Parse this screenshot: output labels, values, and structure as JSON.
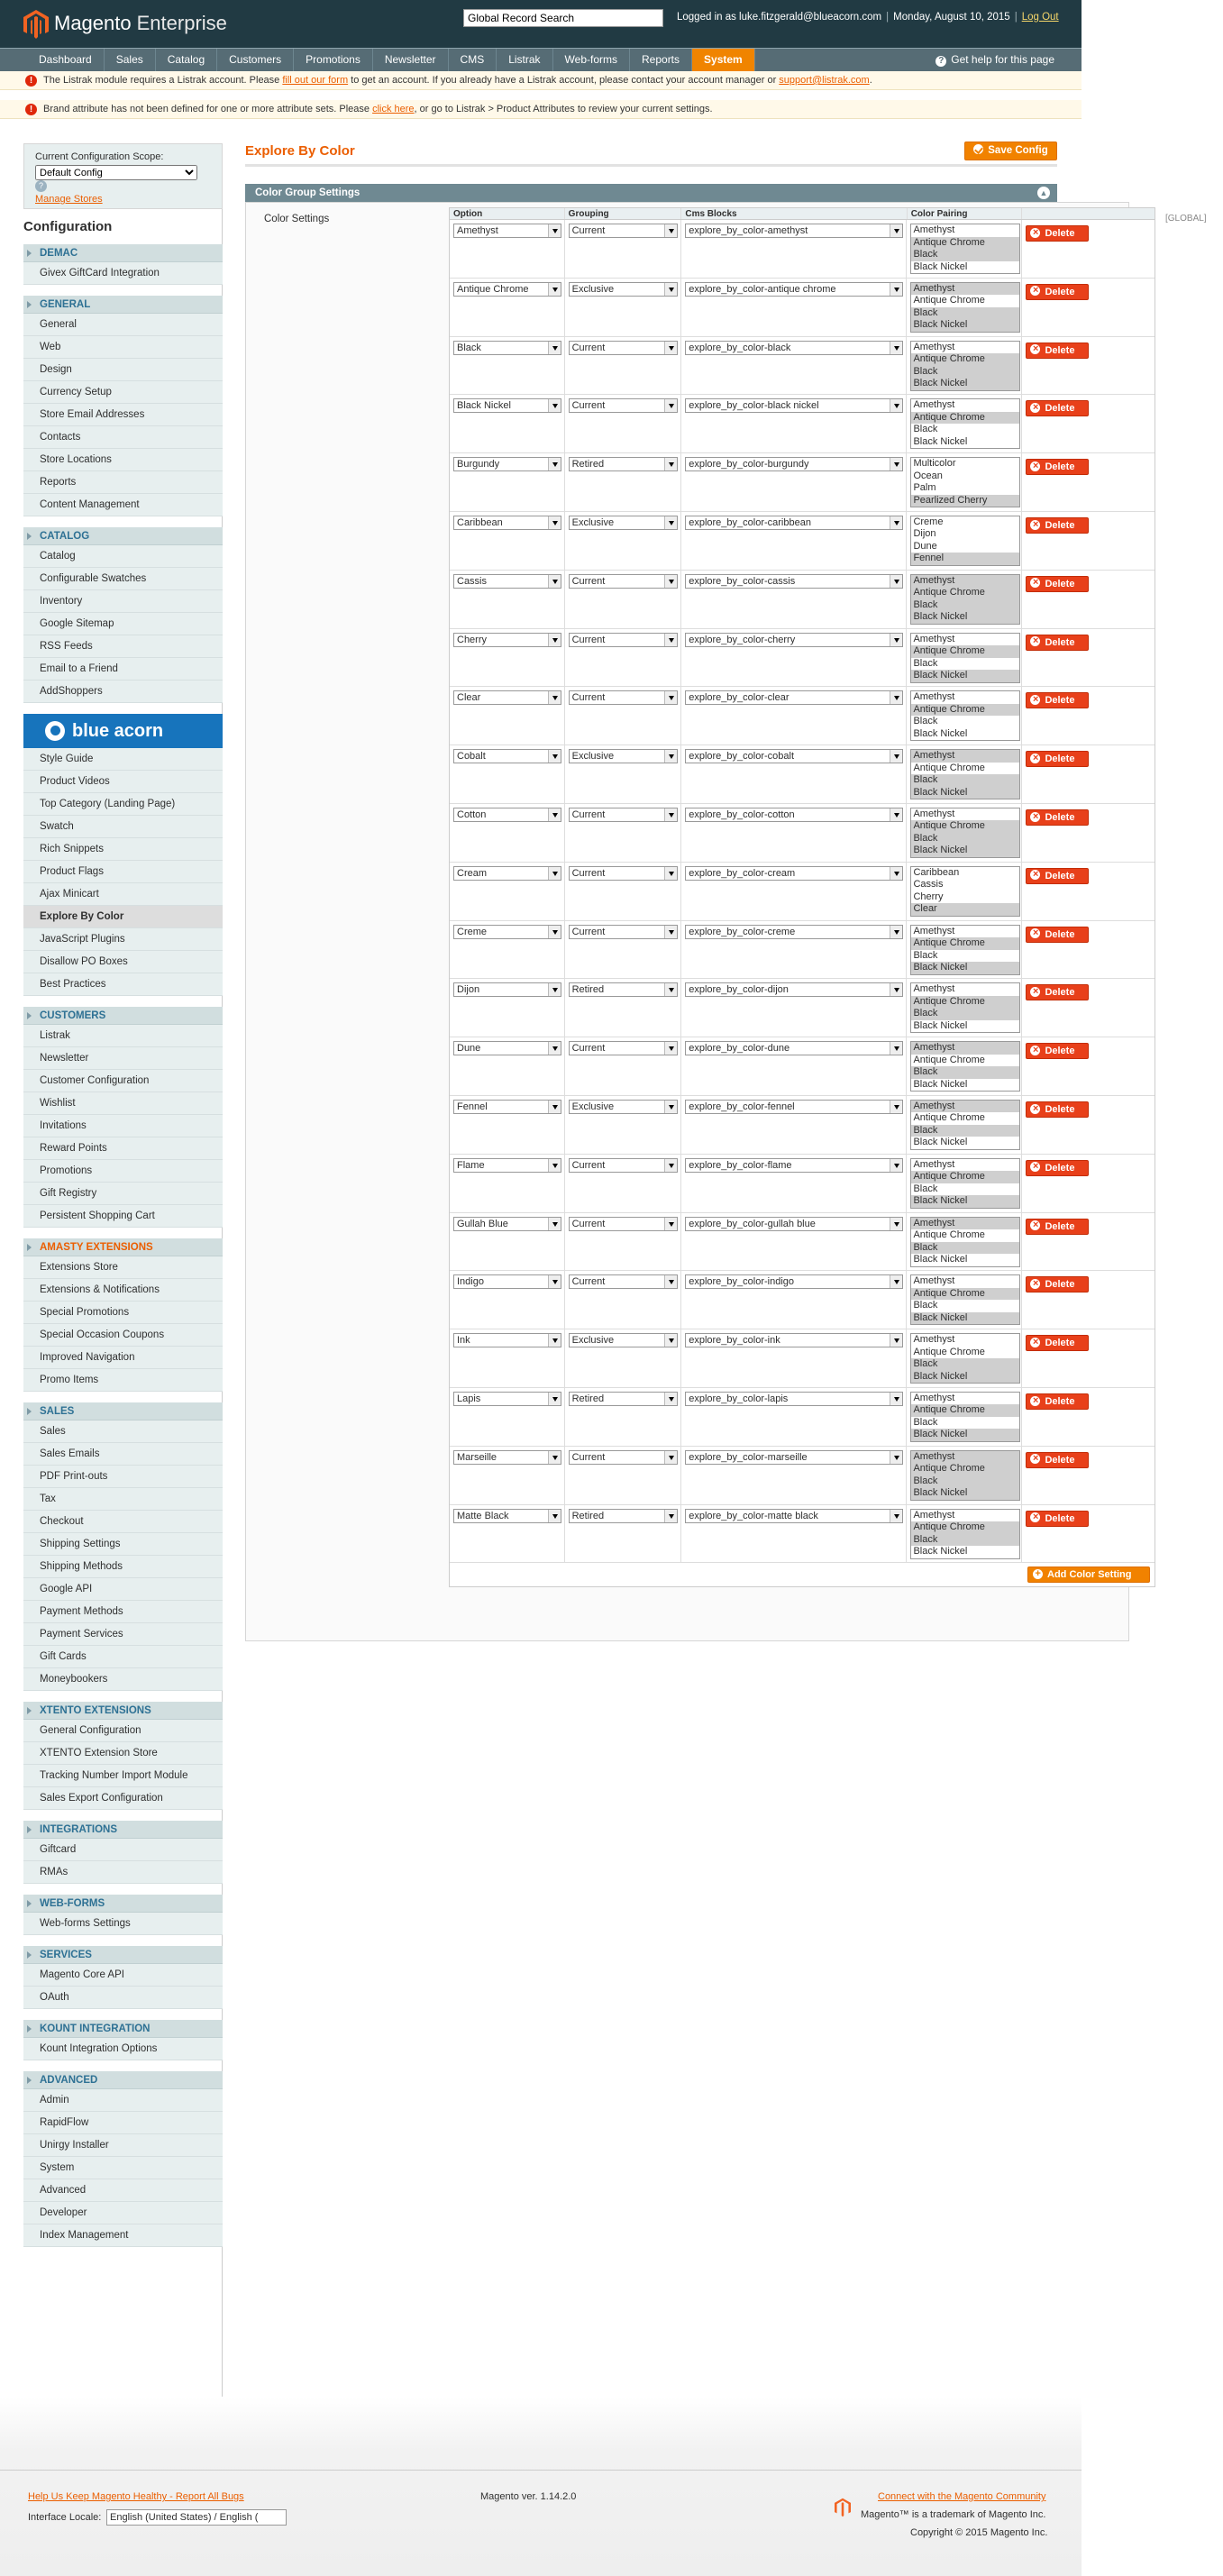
{
  "header": {
    "brand": "Magento",
    "brand_sub": "Enterprise",
    "search_value": "Global Record Search",
    "logged_in": "Logged in as luke.fitzgerald@blueacorn.com",
    "date": "Monday, August 10, 2015",
    "logout": "Log Out"
  },
  "nav": {
    "items": [
      "Dashboard",
      "Sales",
      "Catalog",
      "Customers",
      "Promotions",
      "Newsletter",
      "CMS",
      "Listrak",
      "Web-forms",
      "Reports",
      "System"
    ],
    "active": "System",
    "help": "Get help for this page"
  },
  "messages": {
    "m1_a": "The Listrak module requires a Listrak account. Please ",
    "m1_link1": "fill out our form",
    "m1_b": " to get an account. If you already have a Listrak account, please contact your account manager or ",
    "m1_link2": "support@listrak.com",
    "m1_c": ".",
    "m2_a": "Brand attribute has not been defined for one or more attribute sets. Please ",
    "m2_link": "click here",
    "m2_b": ", or go to Listrak > Product Attributes to review your current settings."
  },
  "scope": {
    "label": "Current Configuration Scope:",
    "value": "Default Config",
    "manage": "Manage Stores"
  },
  "sidebar_title": "Configuration",
  "sections": [
    {
      "title": "DEMAC",
      "items": [
        "Givex GiftCard Integration"
      ]
    },
    {
      "title": "GENERAL",
      "items": [
        "General",
        "Web",
        "Design",
        "Currency Setup",
        "Store Email Addresses",
        "Contacts",
        "Store Locations",
        "Reports",
        "Content Management"
      ]
    },
    {
      "title": "CATALOG",
      "items": [
        "Catalog",
        "Configurable Swatches",
        "Inventory",
        "Google Sitemap",
        "RSS Feeds",
        "Email to a Friend",
        "AddShoppers"
      ]
    },
    {
      "title": "blue acorn",
      "logo": true,
      "items": [
        "Style Guide",
        "Product Videos",
        "Top Category (Landing Page)",
        "Swatch",
        "Rich Snippets",
        "Product Flags",
        "Ajax Minicart",
        "Explore By Color",
        "JavaScript Plugins",
        "Disallow PO Boxes",
        "Best Practices"
      ]
    },
    {
      "title": "CUSTOMERS",
      "items": [
        "Listrak",
        "Newsletter",
        "Customer Configuration",
        "Wishlist",
        "Invitations",
        "Reward Points",
        "Promotions",
        "Gift Registry",
        "Persistent Shopping Cart"
      ]
    },
    {
      "title": "AMASTY EXTENSIONS",
      "amasty": true,
      "items": [
        "Extensions Store",
        "Extensions & Notifications",
        "Special Promotions",
        "Special Occasion Coupons",
        "Improved Navigation",
        "Promo Items"
      ]
    },
    {
      "title": "SALES",
      "items": [
        "Sales",
        "Sales Emails",
        "PDF Print-outs",
        "Tax",
        "Checkout",
        "Shipping Settings",
        "Shipping Methods",
        "Google API",
        "Payment Methods",
        "Payment Services",
        "Gift Cards",
        "Moneybookers"
      ]
    },
    {
      "title": "XTENTO EXTENSIONS",
      "items": [
        "General Configuration",
        "XTENTO Extension Store",
        "Tracking Number Import Module",
        "Sales Export Configuration"
      ]
    },
    {
      "title": "INTEGRATIONS",
      "items": [
        "Giftcard",
        "RMAs"
      ]
    },
    {
      "title": "WEB-FORMS",
      "items": [
        "Web-forms Settings"
      ]
    },
    {
      "title": "SERVICES",
      "items": [
        "Magento Core API",
        "OAuth"
      ]
    },
    {
      "title": "KOUNT INTEGRATION",
      "items": [
        "Kount Integration Options"
      ]
    },
    {
      "title": "ADVANCED",
      "items": [
        "Admin",
        "RapidFlow",
        "Unirgy Installer",
        "System",
        "Advanced",
        "Developer",
        "Index Management"
      ]
    }
  ],
  "sidebar_current": "Explore By Color",
  "main": {
    "title": "Explore By Color",
    "save": "Save Config",
    "fieldset": "Color Group Settings",
    "setting_label": "Color Settings",
    "scope_tag": "[GLOBAL]",
    "columns": [
      "Option",
      "Grouping",
      "Cms Blocks",
      "Color Pairing"
    ],
    "delete": "Delete",
    "add": "Add Color Setting"
  },
  "rows": [
    {
      "option": "Amethyst",
      "grouping": "Current",
      "cms": "explore_by_color-amethyst",
      "pair": [
        "Amethyst",
        "Antique Chrome",
        "Black",
        "Black Nickel"
      ],
      "sel": [
        1,
        2
      ]
    },
    {
      "option": "Antique Chrome",
      "grouping": "Exclusive",
      "cms": "explore_by_color-antique chrome",
      "pair": [
        "Amethyst",
        "Antique Chrome",
        "Black",
        "Black Nickel"
      ],
      "sel": [
        0,
        2,
        3
      ]
    },
    {
      "option": "Black",
      "grouping": "Current",
      "cms": "explore_by_color-black",
      "pair": [
        "Amethyst",
        "Antique Chrome",
        "Black",
        "Black Nickel"
      ],
      "sel": [
        1,
        2,
        3
      ]
    },
    {
      "option": "Black Nickel",
      "grouping": "Current",
      "cms": "explore_by_color-black nickel",
      "pair": [
        "Amethyst",
        "Antique Chrome",
        "Black",
        "Black Nickel"
      ],
      "sel": [
        1
      ]
    },
    {
      "option": "Burgundy",
      "grouping": "Retired",
      "cms": "explore_by_color-burgundy",
      "pair": [
        "Multicolor",
        "Ocean",
        "Palm",
        "Pearlized Cherry"
      ],
      "sel": [
        3
      ]
    },
    {
      "option": "Caribbean",
      "grouping": "Exclusive",
      "cms": "explore_by_color-caribbean",
      "pair": [
        "Creme",
        "Dijon",
        "Dune",
        "Fennel"
      ],
      "sel": [
        3
      ]
    },
    {
      "option": "Cassis",
      "grouping": "Current",
      "cms": "explore_by_color-cassis",
      "pair": [
        "Amethyst",
        "Antique Chrome",
        "Black",
        "Black Nickel"
      ],
      "sel": [
        0,
        1,
        2,
        3
      ]
    },
    {
      "option": "Cherry",
      "grouping": "Current",
      "cms": "explore_by_color-cherry",
      "pair": [
        "Amethyst",
        "Antique Chrome",
        "Black",
        "Black Nickel"
      ],
      "sel": [
        1,
        3
      ]
    },
    {
      "option": "Clear",
      "grouping": "Current",
      "cms": "explore_by_color-clear",
      "pair": [
        "Amethyst",
        "Antique Chrome",
        "Black",
        "Black Nickel"
      ],
      "sel": [
        1
      ]
    },
    {
      "option": "Cobalt",
      "grouping": "Exclusive",
      "cms": "explore_by_color-cobalt",
      "pair": [
        "Amethyst",
        "Antique Chrome",
        "Black",
        "Black Nickel"
      ],
      "sel": [
        0,
        2,
        3
      ]
    },
    {
      "option": "Cotton",
      "grouping": "Current",
      "cms": "explore_by_color-cotton",
      "pair": [
        "Amethyst",
        "Antique Chrome",
        "Black",
        "Black Nickel"
      ],
      "sel": [
        1,
        2,
        3
      ]
    },
    {
      "option": "Cream",
      "grouping": "Current",
      "cms": "explore_by_color-cream",
      "pair": [
        "Caribbean",
        "Cassis",
        "Cherry",
        "Clear"
      ],
      "sel": [
        3
      ]
    },
    {
      "option": "Creme",
      "grouping": "Current",
      "cms": "explore_by_color-creme",
      "pair": [
        "Amethyst",
        "Antique Chrome",
        "Black",
        "Black Nickel"
      ],
      "sel": [
        1,
        3
      ]
    },
    {
      "option": "Dijon",
      "grouping": "Retired",
      "cms": "explore_by_color-dijon",
      "pair": [
        "Amethyst",
        "Antique Chrome",
        "Black",
        "Black Nickel"
      ],
      "sel": [
        1,
        2
      ]
    },
    {
      "option": "Dune",
      "grouping": "Current",
      "cms": "explore_by_color-dune",
      "pair": [
        "Amethyst",
        "Antique Chrome",
        "Black",
        "Black Nickel"
      ],
      "sel": [
        0,
        2
      ]
    },
    {
      "option": "Fennel",
      "grouping": "Exclusive",
      "cms": "explore_by_color-fennel",
      "pair": [
        "Amethyst",
        "Antique Chrome",
        "Black",
        "Black Nickel"
      ],
      "sel": [
        0,
        2
      ]
    },
    {
      "option": "Flame",
      "grouping": "Current",
      "cms": "explore_by_color-flame",
      "pair": [
        "Amethyst",
        "Antique Chrome",
        "Black",
        "Black Nickel"
      ],
      "sel": [
        1,
        3
      ]
    },
    {
      "option": "Gullah Blue",
      "grouping": "Current",
      "cms": "explore_by_color-gullah blue",
      "pair": [
        "Amethyst",
        "Antique Chrome",
        "Black",
        "Black Nickel"
      ],
      "sel": [
        0,
        2
      ]
    },
    {
      "option": "Indigo",
      "grouping": "Current",
      "cms": "explore_by_color-indigo",
      "pair": [
        "Amethyst",
        "Antique Chrome",
        "Black",
        "Black Nickel"
      ],
      "sel": [
        1,
        3
      ]
    },
    {
      "option": "Ink",
      "grouping": "Exclusive",
      "cms": "explore_by_color-ink",
      "pair": [
        "Amethyst",
        "Antique Chrome",
        "Black",
        "Black Nickel"
      ],
      "sel": [
        2,
        3
      ]
    },
    {
      "option": "Lapis",
      "grouping": "Retired",
      "cms": "explore_by_color-lapis",
      "pair": [
        "Amethyst",
        "Antique Chrome",
        "Black",
        "Black Nickel"
      ],
      "sel": [
        1,
        3
      ]
    },
    {
      "option": "Marseille",
      "grouping": "Current",
      "cms": "explore_by_color-marseille",
      "pair": [
        "Amethyst",
        "Antique Chrome",
        "Black",
        "Black Nickel"
      ],
      "sel": [
        0,
        1,
        2,
        3
      ]
    },
    {
      "option": "Matte Black",
      "grouping": "Retired",
      "cms": "explore_by_color-matte black",
      "pair": [
        "Amethyst",
        "Antique Chrome",
        "Black",
        "Black Nickel"
      ],
      "sel": [
        1,
        2
      ]
    }
  ],
  "footer": {
    "bugs": "Help Us Keep Magento Healthy - Report All Bugs",
    "locale_label": "Interface Locale:",
    "locale_value": "English (United States) / English (",
    "version": "Magento ver. 1.14.2.0",
    "community": "Connect with the Magento Community",
    "trademark": "Magento™ is a trademark of Magento Inc.",
    "copyright": "Copyright © 2015 Magento Inc."
  }
}
